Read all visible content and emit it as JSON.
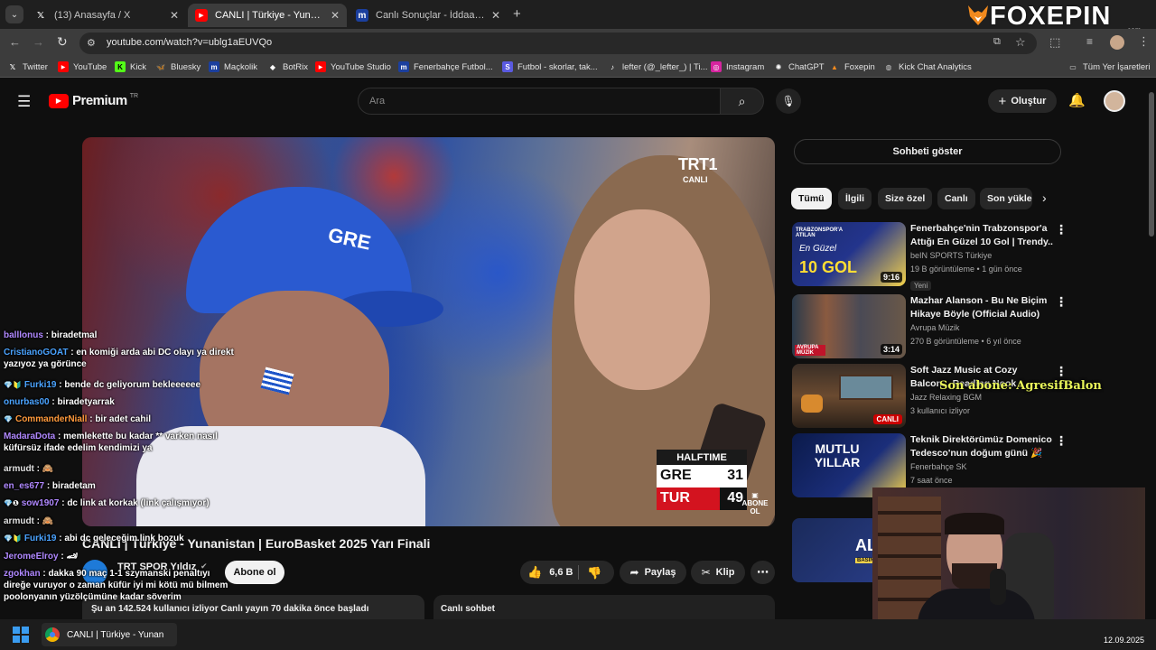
{
  "browser": {
    "tabs": [
      {
        "label": "(13) Anasayfa / X",
        "favicon": "x-icon",
        "active": false
      },
      {
        "label": "CANLI | Türkiye - Yunanistan | E",
        "favicon": "youtube-icon",
        "active": true
      },
      {
        "label": "Canlı Sonuçlar - İddaa Sonuçlar",
        "favicon": "maclolik-icon",
        "active": false
      }
    ],
    "url": "youtube.com/watch?v=ublg1aEUVQo",
    "bookmarks": [
      "Twitter",
      "YouTube",
      "Kick",
      "Bluesky",
      "Maçkolik",
      "BotRix",
      "YouTube Studio",
      "Fenerbahçe Futbol...",
      "Futbol - skorlar, tak...",
      "lefter (@_lefter_) | Ti...",
      "Instagram",
      "ChatGPT",
      "Foxepin",
      "Kick Chat Analytics"
    ],
    "all_bookmarks": "Tüm Yer İşaretleri"
  },
  "watermark": {
    "brand": "FOXEPIN",
    "sub": ".com"
  },
  "youtube": {
    "logo": "Premium",
    "logo_region": "TR",
    "search_placeholder": "Ara",
    "create_label": "Oluştur",
    "video": {
      "broadcaster": "TRT1",
      "broadcaster_sub": "CANLI",
      "score_header": "HALFTIME",
      "team_a": "GRE",
      "score_a": "31",
      "team_b": "TUR",
      "score_b": "49",
      "subscribe_overlay_1": "ABONE",
      "subscribe_overlay_2": "OL",
      "cap_text": "GRE"
    },
    "title": "CANLI | Türkiye - Yunanistan | EuroBasket 2025 Yarı Finali",
    "channel": "TRT SPOR Yıldız",
    "subscribe": "Abone ol",
    "likes": "6,6 B",
    "share": "Paylaş",
    "clip": "Klip",
    "viewers": "Şu an 142.524 kullanıcı izliyor  Canlı yayın 70 dakika önce başladı",
    "live_chat": "Canlı sohbet",
    "show_chat": "Sohbeti göster",
    "chips": [
      "Tümü",
      "İlgili",
      "Size özel",
      "Canlı",
      "Son yükle"
    ],
    "recommendations": [
      {
        "title_1": "Fenerbahçe'nin Trabzonspor'a",
        "title_2": "Attığı En Güzel 10 Gol | Trendy...",
        "channel": "beIN SPORTS Türkiye",
        "meta": "19 B görüntüleme • 1 gün önce",
        "badge": "Yeni",
        "duration": "9:16",
        "thumb_text": "10 GOL",
        "thumb_small": "TRABZONSPOR'A ATILAN",
        "thumb_script": "En Güzel"
      },
      {
        "title_1": "Mazhar Alanson - Bu Ne Biçim",
        "title_2": "Hikaye Böyle (Official Audio)",
        "channel": "Avrupa Müzik",
        "meta": "270 B görüntüleme • 6 yıl önce",
        "duration": "3:14",
        "thumb_text": "AVRUPA MÜZİK"
      },
      {
        "title_1": "Soft Jazz Music at Cozy",
        "title_2": "Balcon... Reading Nook",
        "channel": "Jazz Relaxing BGM",
        "meta": "3 kullanıcı izliyor",
        "duration": "CANLI"
      },
      {
        "title_1": "Teknik Direktörümüz Domenico",
        "title_2": "Tedesco'nun doğum günü 🎉",
        "channel": "Fenerbahçe SK",
        "meta": "7 saat önce",
        "thumb_text": "MUTLU YILLAR"
      },
      {
        "thumb_text": "ALİ",
        "thumb_small": "BASIN A"
      }
    ]
  },
  "stream_overlay": {
    "alert": "Son abone: AgresifBalon"
  },
  "chat": [
    {
      "user": "balllonus",
      "color": "#b088ff",
      "msg": " : biradetmal"
    },
    {
      "user": "CristianoGOAT",
      "color": "#4aa3ff",
      "msg": " : en komiği arda abi DC olayı ya direkt yazıyoz ya görünce"
    },
    {
      "user": "Furki19",
      "color": "#4aa3ff",
      "msg": " : bende dc geliyorum bekleeeeee",
      "badges": "💎🔰"
    },
    {
      "user": "onurbas00",
      "color": "#4aa3ff",
      "msg": " : biradetyarrak"
    },
    {
      "user": "CommanderNiall",
      "color": "#ff9a3c",
      "msg": " : bir adet cahil",
      "badges": "💎"
    },
    {
      "user": "MadaraDota",
      "color": "#b088ff",
      "msg": " : memlekette bu kadar ** varken nasıl küfürsüz ifade edelim kendimizi ya"
    },
    {
      "user": "armudt",
      "color": "#e0e0e0",
      "msg": " : 🙈"
    },
    {
      "user": "en_es677",
      "color": "#b088ff",
      "msg": " : biradetam"
    },
    {
      "user": "sow1907",
      "color": "#b088ff",
      "msg": " : dc link at korkak (link çalışmıyor)",
      "badges": "💎❶"
    },
    {
      "user": "armudt",
      "color": "#e0e0e0",
      "msg": " : 🙈"
    },
    {
      "user": "Furki19",
      "color": "#4aa3ff",
      "msg": " : abi dc geleceğim link bozuk",
      "badges": "💎🔰"
    },
    {
      "user": "JeromeElroy",
      "color": "#b088ff",
      "msg": " : 🏎"
    },
    {
      "user": "zgokhan",
      "color": "#b088ff",
      "msg": " : dakka 90 maç 1-1 szymanski penaltıyı direğe vuruyor o zaman küfür iyi mi kötü mü bilmem poolonyanın yüzölçümüne kadar söverim"
    }
  ],
  "taskbar": {
    "window": "CANLI | Türkiye - Yunan",
    "date": "12.09.2025"
  },
  "colors": {
    "youtube_red": "#ff0000",
    "bg": "#0f0f0f",
    "chip_active": "#f1f1f1"
  }
}
